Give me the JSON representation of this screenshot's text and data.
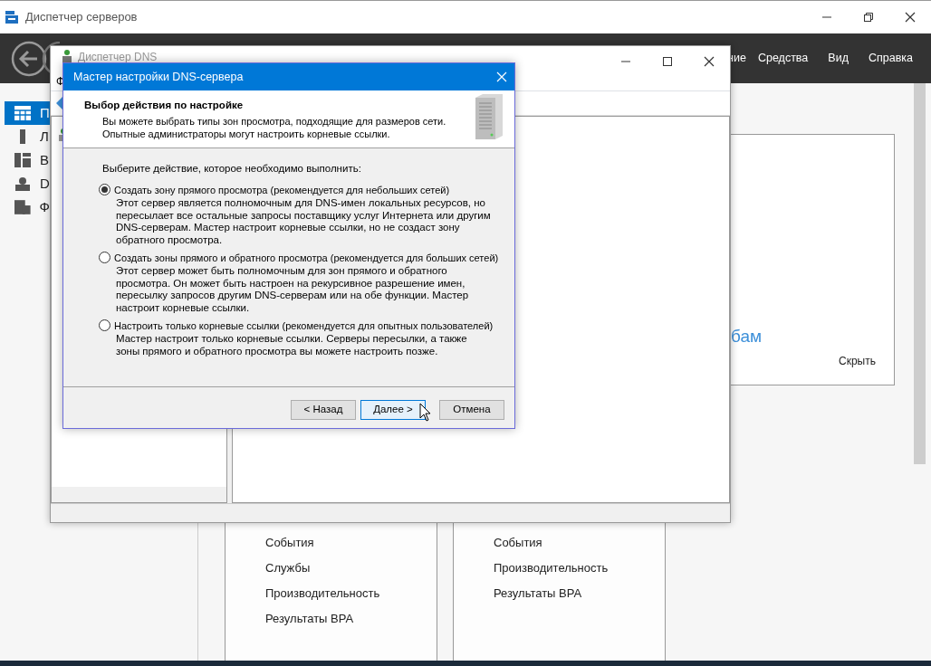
{
  "server_manager": {
    "title": "Диспетчер серверов",
    "menu": [
      "ние",
      "Средства",
      "Вид",
      "Справка"
    ],
    "sidebar": [
      {
        "label": "П",
        "selected": true
      },
      {
        "label": "Л",
        "selected": false
      },
      {
        "label": "В",
        "selected": false
      },
      {
        "label": "D",
        "selected": false
      },
      {
        "label": "Ф",
        "selected": false
      }
    ],
    "partial_heading": "бам",
    "hide_link": "Скрыть",
    "tiles": [
      {
        "items": [
          "События",
          "Службы",
          "Производительность",
          "Результаты BPA"
        ]
      },
      {
        "items": [
          "События",
          "Производительность",
          "Результаты BPA"
        ]
      }
    ]
  },
  "dns_manager": {
    "title": "Диспетчер DNS",
    "menu": [
      "Ф"
    ]
  },
  "wizard": {
    "title": "Мастер настройки DNS-сервера",
    "heading": "Выбор действия по настройке",
    "subtitle": [
      "Вы можете выбрать типы зон просмотра, подходящие для размеров сети.",
      "Опытные администраторы могут настроить корневые ссылки."
    ],
    "prompt": "Выберите действие, которое необходимо выполнить:",
    "options": [
      {
        "label": "Создать зону прямого просмотра (рекомендуется для небольших сетей)",
        "selected": true,
        "description": [
          "Этот сервер является полномочным для DNS-имен локальных ресурсов, но",
          "пересылает все остальные запросы поставщику услуг Интернета или другим",
          "DNS-серверам. Мастер настроит корневые ссылки, но не создаст зону",
          "обратного просмотра."
        ]
      },
      {
        "label": "Создать зоны прямого и обратного просмотра (рекомендуется для больших сетей)",
        "selected": false,
        "description": [
          "Этот сервер может быть полномочным для зон прямого и обратного",
          "просмотра. Он может быть настроен на рекурсивное разрешение имен,",
          "пересылку запросов другим DNS-серверам или на обе функции. Мастер",
          "настроит корневые ссылки."
        ]
      },
      {
        "label": "Настроить только корневые ссылки (рекомендуется для опытных пользователей)",
        "selected": false,
        "description": [
          "Мастер настроит только корневые ссылки. Серверы пересылки, а также",
          "зоны прямого и обратного просмотра вы можете настроить позже."
        ]
      }
    ],
    "buttons": [
      {
        "label": "< Назад",
        "focused": false
      },
      {
        "label": "Далее >",
        "focused": true
      },
      {
        "label": "Отмена",
        "focused": false
      }
    ]
  }
}
